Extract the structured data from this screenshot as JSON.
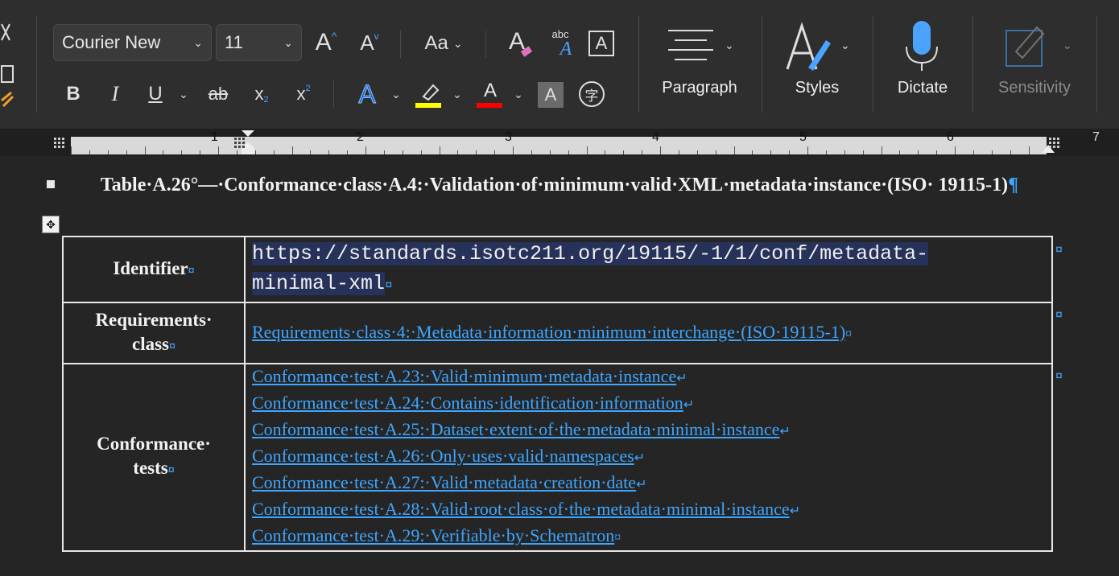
{
  "ribbon": {
    "font_name": "Courier New",
    "font_size": "11",
    "grow_font_label": "A",
    "shrink_font_label": "A",
    "change_case_label": "Aa",
    "clear_format_label": "A",
    "abc_label": "abc",
    "text_effects_label": "A",
    "bold_label": "B",
    "italic_label": "I",
    "underline_label": "U",
    "strike_label": "ab",
    "subscript_label": "x",
    "subscript_mark": "2",
    "superscript_label": "x",
    "superscript_mark": "2",
    "font_color_label": "A",
    "char_shading_label": "A",
    "phonetic_label": "字",
    "paragraph_label": "Paragraph",
    "styles_label": "Styles",
    "dictate_label": "Dictate",
    "sensitivity_label": "Sensitivity",
    "highlight_color": "#ffff00",
    "font_color": "#ff0000"
  },
  "ruler": {
    "numbers": [
      "1",
      "2",
      "3",
      "4",
      "5",
      "6",
      "7"
    ]
  },
  "document": {
    "caption": "Table·A.26°—·Conformance·class·A.4:·Validation·of·minimum·valid·XML·metadata·instance·(ISO· 19115-1)",
    "pilcrow": "¶",
    "table": {
      "identifier_label": "Identifier",
      "identifier_value_line1": "https://standards.isotc211.org/19115/-1/1/conf/metadata-",
      "identifier_value_line2": "minimal-xml",
      "requirements_label_line1": "Requirements·",
      "requirements_label_line2": "class",
      "requirements_value": "Requirements·class·4:·Metadata·information·minimum·interchange·(ISO·19115-1)",
      "tests_label_line1": "Conformance·",
      "tests_label_line2": "tests",
      "tests": [
        "Conformance·test·A.23:·Valid·minimum·metadata·instance",
        "Conformance·test·A.24:·Contains·identification·information",
        "Conformance·test·A.25:·Dataset·extent·of·the·metadata·minimal·instance",
        "Conformance·test·A.26:·Only·uses·valid·namespaces",
        "Conformance·test·A.27:·Valid·metadata·creation·date",
        "Conformance·test·A.28:·Valid·root·class·of·the·metadata·minimal·instance",
        "Conformance·test·A.29:·Verifiable·by·Schematron"
      ],
      "line_break_mark": "↵",
      "cell_end_mark": "¤"
    }
  }
}
